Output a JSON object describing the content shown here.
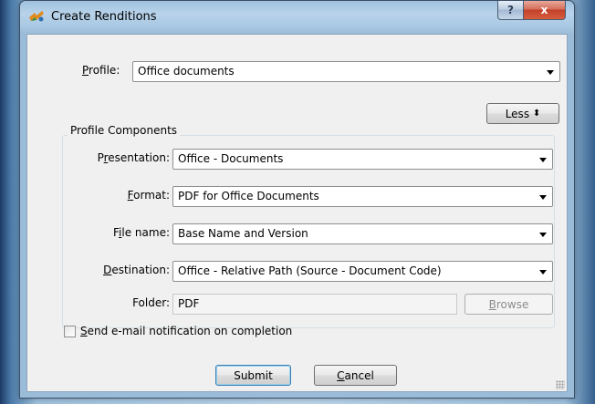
{
  "window": {
    "title": "Create Renditions",
    "app_icon": "renditions-app-icon",
    "help_label": "?",
    "close_label": "x"
  },
  "profile": {
    "label": "Profile:",
    "mnemonic": "P",
    "label_rest": "rofile:",
    "value": "Office documents"
  },
  "less_button": {
    "label": "Less",
    "glyph": "⬍"
  },
  "profile_components": {
    "title": "Profile Components",
    "presentation": {
      "pre": "P",
      "mn": "r",
      "post": "esentation:",
      "value": "Office - Documents"
    },
    "format": {
      "pre": "",
      "mn": "F",
      "post": "ormat:",
      "value": "PDF for Office Documents"
    },
    "file_name": {
      "pre": "F",
      "mn": "i",
      "post": "le name:",
      "value": "Base Name and Version"
    },
    "destination": {
      "pre": "",
      "mn": "D",
      "post": "estination:",
      "value": "Office - Relative Path (Source - Document Code)"
    },
    "folder": {
      "label": "Folder:",
      "value": "PDF"
    },
    "browse_button": {
      "pre": "",
      "mn": "B",
      "post": "rowse"
    }
  },
  "notify": {
    "pre": "",
    "mn": "S",
    "post": "end e-mail notification on completion",
    "checked": false
  },
  "submit_button": {
    "label": "Submit"
  },
  "cancel_button": {
    "pre": "",
    "mn": "C",
    "post": "ancel"
  }
}
